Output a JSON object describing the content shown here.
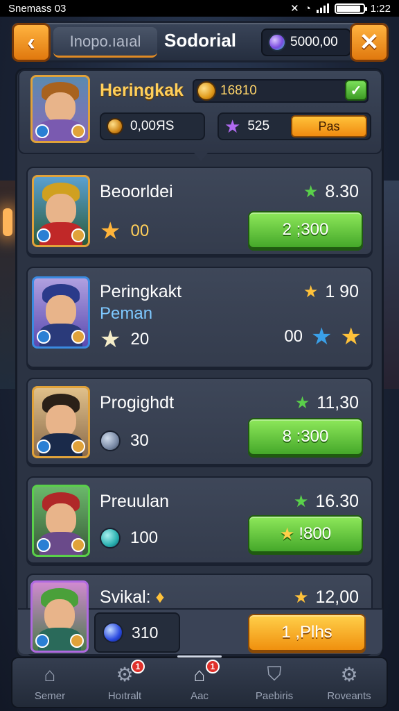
{
  "status_bar": {
    "carrier": "Snemass 03",
    "time": "1:22"
  },
  "header": {
    "back_icon": "chevron-left-icon",
    "tab_inactive_label": "Inopo.ıaıal",
    "title": "Sodorial",
    "gems": "5000,00",
    "close_icon": "close-x-icon"
  },
  "profile": {
    "name": "Heringkak",
    "gold": "16810",
    "coins": "0,00ЯS",
    "stars": "525",
    "action_label": "Pas"
  },
  "cards": [
    {
      "title": "Beoorldei",
      "sub": "",
      "rating": "8.30",
      "rating_star": "green",
      "resource_value": "00",
      "resource_icon": "gold-star-icon",
      "button_label": "2 ;300",
      "button_type": "green"
    },
    {
      "title": "Peringkakt",
      "sub": "Peman",
      "rating": "1 90",
      "rating_star": "yellow",
      "resource_value": "20",
      "resource_icon": "white-star-icon",
      "extra_value": "00",
      "button_type": "stars"
    },
    {
      "title": "Progighdt",
      "sub": "",
      "rating": "11,30",
      "rating_star": "green",
      "resource_value": "30",
      "resource_icon": "gray-orb-icon",
      "button_label": "8 :300",
      "button_type": "green"
    },
    {
      "title": "Preuulan",
      "sub": "",
      "rating": "16.30",
      "rating_star": "green",
      "resource_value": "100",
      "resource_icon": "teal-orb-icon",
      "button_label": "!800",
      "button_type": "green-star"
    },
    {
      "title": "Svikal:",
      "sub": "",
      "rating": "12,00",
      "rating_star": "yellow",
      "resource_value": "310",
      "resource_icon": "blue-orb-icon",
      "button_label": "1 ,Plhs",
      "button_type": "orange"
    }
  ],
  "nav": [
    {
      "label": "Semer",
      "icon": "home-icon",
      "badge": ""
    },
    {
      "label": "Hoıtralt",
      "icon": "gears-icon",
      "badge": "1"
    },
    {
      "label": "Aac",
      "icon": "house-up-icon",
      "badge": "1"
    },
    {
      "label": "Paebiris",
      "icon": "shield-icon",
      "badge": ""
    },
    {
      "label": "Roveants",
      "icon": "gear-icon",
      "badge": ""
    }
  ],
  "colors": {
    "accent_orange": "#f08a10",
    "accent_green": "#45a82a",
    "panel": "#2b3343",
    "gold_text": "#ffcf5a"
  }
}
